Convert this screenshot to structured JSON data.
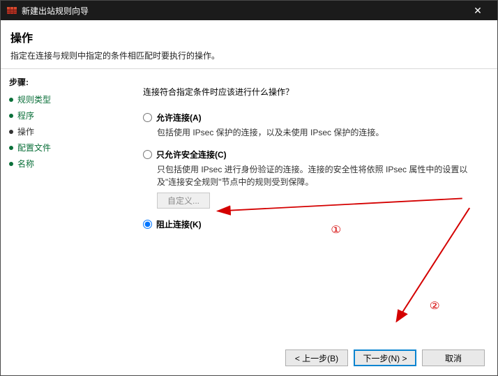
{
  "window": {
    "title": "新建出站规则向导",
    "close_glyph": "✕"
  },
  "header": {
    "title": "操作",
    "subtitle": "指定在连接与规则中指定的条件相匹配时要执行的操作。"
  },
  "sidebar": {
    "title": "步骤:",
    "steps": [
      {
        "label": "规则类型",
        "current": false
      },
      {
        "label": "程序",
        "current": false
      },
      {
        "label": "操作",
        "current": true
      },
      {
        "label": "配置文件",
        "current": false
      },
      {
        "label": "名称",
        "current": false
      }
    ]
  },
  "content": {
    "question": "连接符合指定条件时应该进行什么操作？",
    "options": [
      {
        "id": "allow",
        "label": "允许连接(A)",
        "desc": "包括使用 IPsec 保护的连接，以及未使用 IPsec 保护的连接。",
        "checked": false
      },
      {
        "id": "allow_secure",
        "label": "只允许安全连接(C)",
        "desc": "只包括使用 IPsec 进行身份验证的连接。连接的安全性将依照 IPsec 属性中的设置以及\"连接安全规则\"节点中的规则受到保障。",
        "checked": false,
        "custom_label": "自定义..."
      },
      {
        "id": "block",
        "label": "阻止连接(K)",
        "desc": "",
        "checked": true
      }
    ]
  },
  "footer": {
    "back": "< 上一步(B)",
    "next": "下一步(N) >",
    "cancel": "取消"
  },
  "annotations": {
    "mark1": "①",
    "mark2": "②"
  }
}
